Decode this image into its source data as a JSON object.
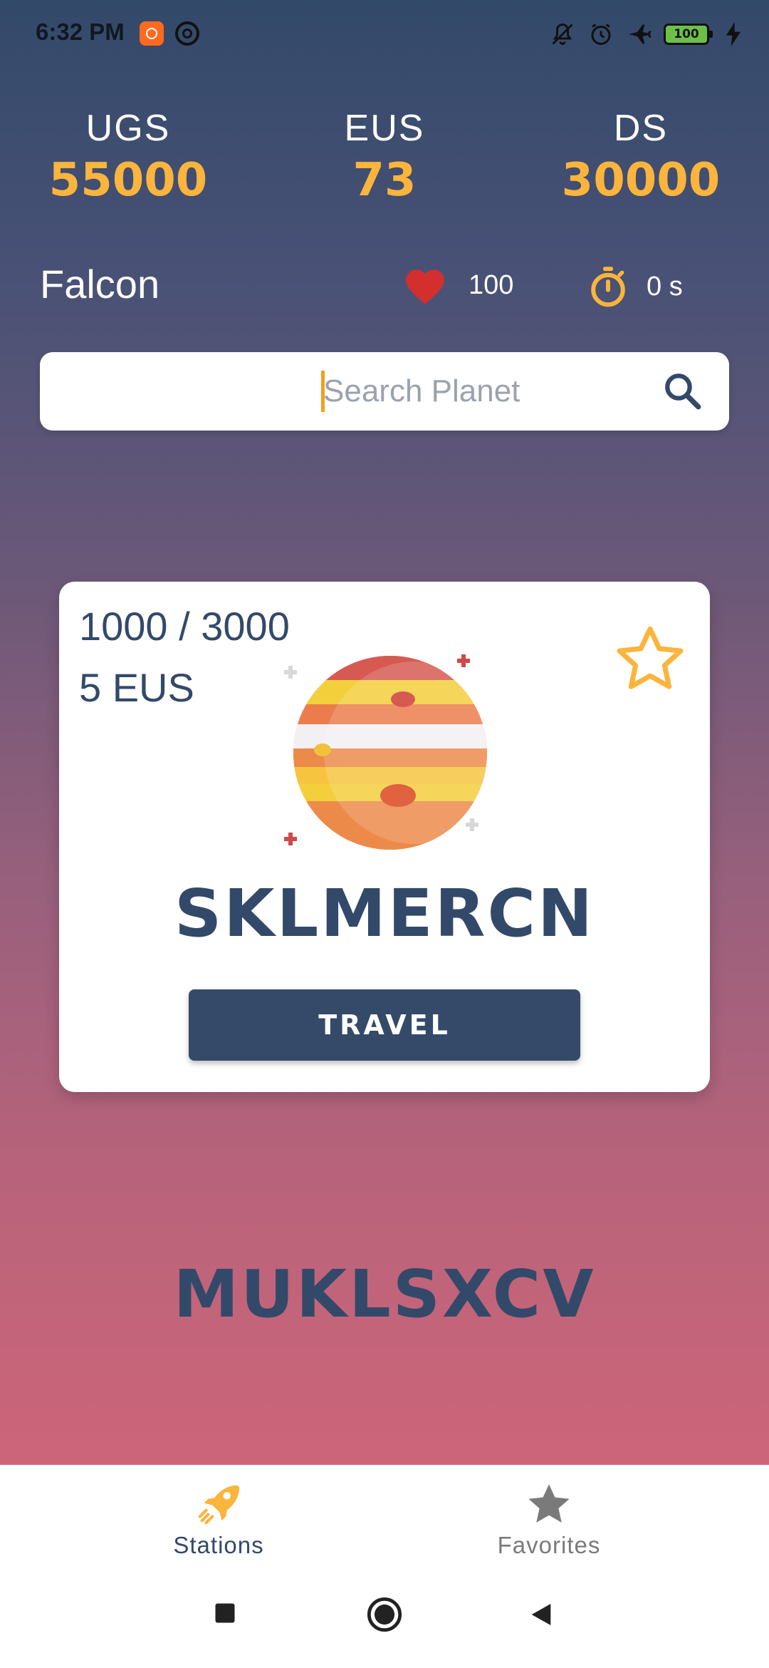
{
  "status_bar": {
    "time": "6:32 PM",
    "battery": "100",
    "icons": [
      "app-notification-icon",
      "sync-icon",
      "mute-icon",
      "alarm-icon",
      "airplane-mode-icon",
      "battery-icon",
      "charging-icon"
    ]
  },
  "stats": [
    {
      "label": "UGS",
      "value": "55000"
    },
    {
      "label": "EUS",
      "value": "73"
    },
    {
      "label": "DS",
      "value": "30000"
    }
  ],
  "player": {
    "name": "Falcon",
    "health": "100",
    "time": "0 s"
  },
  "search": {
    "placeholder": "Search Planet",
    "value": ""
  },
  "current_planet": {
    "capacity": "1000 / 3000",
    "cost": "5 EUS",
    "name": "SKLMERCN",
    "travel_label": "TRAVEL",
    "favorite": false
  },
  "next_planet": {
    "name": "MUKLSXCV"
  },
  "bottom_nav": {
    "items": [
      {
        "label": "Stations",
        "icon": "rocket-icon",
        "active": true
      },
      {
        "label": "Favorites",
        "icon": "star-icon",
        "active": false
      }
    ]
  },
  "colors": {
    "accent": "#fbb43c",
    "primary": "#33496a",
    "heart": "#d32f2f",
    "inactive": "#7a7a7a"
  }
}
